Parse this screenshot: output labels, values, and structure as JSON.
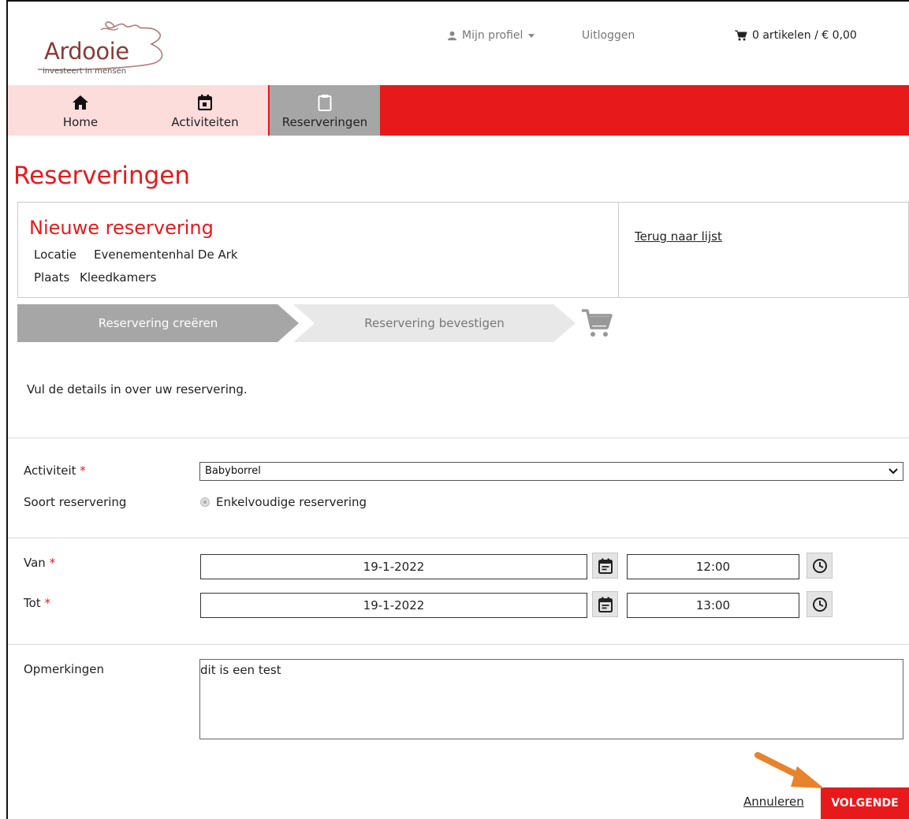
{
  "header": {
    "logo_text": "Ardooie",
    "logo_tagline": "investeert in mensen",
    "profile_label": "Mijn profiel",
    "logout_label": "Uitloggen",
    "cart_label": "0 artikelen / € 0,00"
  },
  "menu": {
    "items": [
      {
        "label": "Home",
        "icon": "home-icon"
      },
      {
        "label": "Activiteiten",
        "icon": "calendar-icon"
      },
      {
        "label": "Reserveringen",
        "icon": "clipboard-icon",
        "active": true
      }
    ]
  },
  "page": {
    "title": "Reserveringen"
  },
  "card": {
    "title": "Nieuwe reservering",
    "location_label": "Locatie",
    "location_value": "Evenementenhal De Ark",
    "place_label": "Plaats",
    "place_value": "Kleedkamers",
    "back_link": "Terug naar lijst"
  },
  "steps": {
    "step1": "Reservering creëren",
    "step2": "Reservering bevestigen"
  },
  "form": {
    "intro": "Vul de details in over uw reservering.",
    "activity_label": "Activiteit",
    "activity_value": "Babyborrel",
    "type_label": "Soort reservering",
    "type_value": "Enkelvoudige reservering",
    "from_label": "Van",
    "from_date": "19-1-2022",
    "from_time": "12:00",
    "to_label": "Tot",
    "to_date": "19-1-2022",
    "to_time": "13:00",
    "remarks_label": "Opmerkingen",
    "remarks_value": "dit is een test",
    "required_mark": "*"
  },
  "actions": {
    "cancel_label": "Annuleren",
    "next_label": "VOLGENDE"
  },
  "colors": {
    "brand_red": "#e8191b",
    "menu_light": "#fddcdc",
    "active_grey": "#a6a6a6",
    "arrow_orange": "#e8822b"
  }
}
